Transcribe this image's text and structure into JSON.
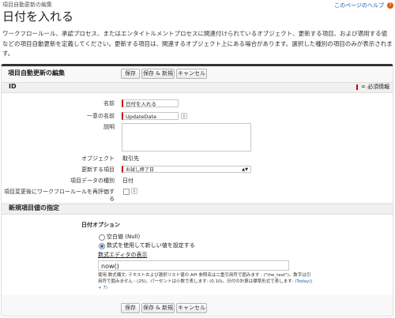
{
  "header": {
    "breadcrumb": "項目自動更新の編集",
    "help_link": "このページのヘルプ",
    "title": "日付を入れる",
    "description": "ワークフロールール、承認プロセス、またはエンタイトルメントプロセスに関連付けられているオブジェクト、更新する項目、および適用する値などの項目自動更新を定義してください。更新する項目は、関連するオブジェクト上にある場合があります。選択した種別の項目のみが表示されます。"
  },
  "panel": {
    "title": "項目自動更新の編集",
    "buttons": {
      "save": "保存",
      "save_new": "保存 & 新規",
      "cancel": "キャンセル"
    }
  },
  "id_section": {
    "title": "ID",
    "required_info": "= 必須情報"
  },
  "fields": {
    "name_label": "名前",
    "name_value": "日付を入れる",
    "unique_name_label": "一意の名前",
    "unique_name_value": "UpdateDate",
    "description_label": "説明",
    "description_value": "",
    "object_label": "オブジェクト",
    "object_value": "取引先",
    "field_to_update_label": "更新する項目",
    "field_to_update_value": "お試し終了日",
    "field_type_label": "項目データの種別",
    "field_type_value": "日付",
    "reevaluate_label": "項目変更後にワークフロールールを再評価する",
    "info_icon": "i"
  },
  "new_value_section": {
    "title": "新規項目値の指定",
    "date_options_label": "日付オプション",
    "option_blank": "空白値 (Null)",
    "option_formula": "数式を使用して新しい値を設定する",
    "formula_editor_link": "数式エディタの表示",
    "formula_value": "now()",
    "help_text_1": "使用 数式構文: テキストおよび選択リスト値の API 参照名は二重引用符で囲みます : (\"the_text\")。数字は引用符で囲みません : (25)。パーセントは小数で表します: (0.10)。日付の計算は標準形式で表します:",
    "help_text_2": "(Today() + 7)"
  },
  "colors": {
    "required": "#cc0000",
    "link": "#1a5fb4",
    "panel_border": "#333333"
  }
}
